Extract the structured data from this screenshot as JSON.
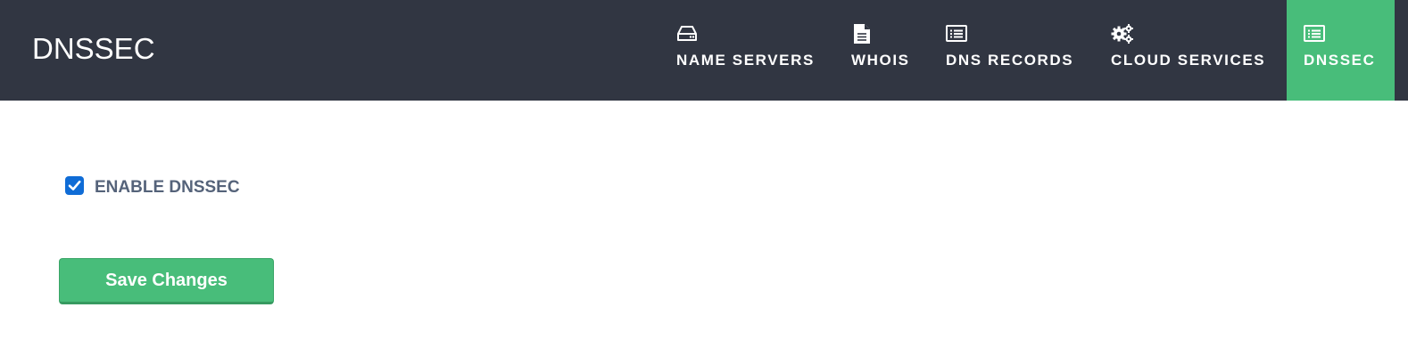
{
  "header": {
    "title": "DNSSEC",
    "nav": [
      {
        "label": "NAME SERVERS",
        "icon": "hard-drive-icon",
        "active": false
      },
      {
        "label": "WHOIS",
        "icon": "document-icon",
        "active": false
      },
      {
        "label": "DNS RECORDS",
        "icon": "list-icon",
        "active": false
      },
      {
        "label": "CLOUD SERVICES",
        "icon": "gears-icon",
        "active": false
      },
      {
        "label": "DNSSEC",
        "icon": "list-icon",
        "active": true
      }
    ]
  },
  "main": {
    "enable_dnssec": {
      "label": "ENABLE DNSSEC",
      "checked": true
    },
    "save_label": "Save Changes"
  },
  "colors": {
    "header_bg": "#313642",
    "accent": "#48bd7a",
    "checkbox": "#0f6cd6",
    "label_text": "#55637a"
  }
}
